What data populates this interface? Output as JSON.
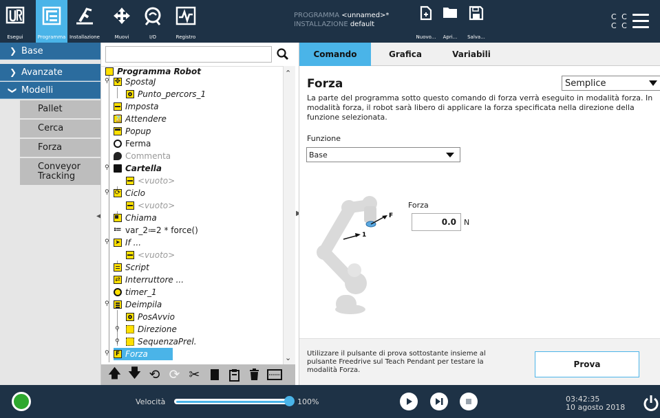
{
  "header": {
    "nav": [
      {
        "label": "Esegui",
        "icon": "ur-logo-icon"
      },
      {
        "label": "Programma",
        "icon": "program-icon",
        "active": true
      },
      {
        "label": "Installazione",
        "icon": "installation-icon"
      },
      {
        "label": "Muovi",
        "icon": "move-icon"
      },
      {
        "label": "I/O",
        "icon": "io-icon"
      },
      {
        "label": "Registro",
        "icon": "log-icon"
      }
    ],
    "program_key": "PROGRAMMA",
    "program_value": "<unnamed>*",
    "installation_key": "INSTALLAZIONE",
    "installation_value": "default",
    "file_buttons": [
      {
        "label": "Nuovo...",
        "icon": "new-file-icon"
      },
      {
        "label": "Apri...",
        "icon": "open-folder-icon"
      },
      {
        "label": "Salva...",
        "icon": "save-icon"
      }
    ],
    "cc_line1": "C C",
    "cc_line2": "C C"
  },
  "leftnav": {
    "sections": [
      {
        "label": "Base",
        "expanded": false
      },
      {
        "label": "Avanzate",
        "expanded": false
      },
      {
        "label": "Modelli",
        "expanded": true
      }
    ],
    "items": [
      "Pallet",
      "Cerca",
      "Forza",
      "Conveyor Tracking"
    ]
  },
  "tree": {
    "search_placeholder": "",
    "rows": [
      {
        "text": "Programma Robot",
        "icon": "program-root-icon"
      },
      {
        "text": "SpostaJ",
        "icon": "move-icon"
      },
      {
        "text": "Punto_percors_1",
        "icon": "waypoint-icon"
      },
      {
        "text": "Imposta",
        "icon": "set-icon"
      },
      {
        "text": "Attendere",
        "icon": "wait-icon"
      },
      {
        "text": "Popup",
        "icon": "popup-icon"
      },
      {
        "text": "Ferma",
        "icon": "halt-icon"
      },
      {
        "text": "Commenta",
        "icon": "comment-icon"
      },
      {
        "text": "Cartella",
        "icon": "folder-icon"
      },
      {
        "text": "<vuoto>",
        "icon": "empty-icon"
      },
      {
        "text": "Ciclo",
        "icon": "loop-icon"
      },
      {
        "text": "<vuoto>",
        "icon": "empty-icon"
      },
      {
        "text": "Chiama",
        "icon": "call-icon"
      },
      {
        "text": "var_2≔2 * force()",
        "icon": "assignment-icon"
      },
      {
        "text": "If ...",
        "icon": "if-icon"
      },
      {
        "text": "<vuoto>",
        "icon": "empty-icon"
      },
      {
        "text": "Script",
        "icon": "script-icon"
      },
      {
        "text": "Interruttore ...",
        "icon": "switch-icon"
      },
      {
        "text": "timer_1",
        "icon": "timer-icon"
      },
      {
        "text": "Deimpila",
        "icon": "destack-icon"
      },
      {
        "text": "PosAvvio",
        "icon": "waypoint-icon"
      },
      {
        "text": "Direzione",
        "icon": "direction-icon"
      },
      {
        "text": "SequenzaPrel.",
        "icon": "sequence-icon"
      },
      {
        "text": "Forza",
        "icon": "force-icon",
        "selected": true
      }
    ],
    "toolbar": [
      "move-up-icon",
      "move-down-icon",
      "undo-icon",
      "redo-icon",
      "cut-icon",
      "copy-icon",
      "paste-icon",
      "delete-icon",
      "suppress-icon"
    ]
  },
  "panel": {
    "tabs": [
      "Comando",
      "Grafica",
      "Variabili"
    ],
    "title": "Forza",
    "mode": "Semplice",
    "description": "La parte del programma sotto questo comando di forza verrà eseguito in modalità forza. In modalità forza, il robot sarà libero di applicare la forza specificata nella direzione della funzione selezionata.",
    "function_label": "Funzione",
    "function_value": "Base",
    "force_label": "Forza",
    "force_value": "0.0",
    "force_unit": "N",
    "arrow_label_f": "F",
    "arrow_label_1": "1",
    "hint": "Utilizzare il pulsante di prova sottostante insieme al pulsante Freedrive sul Teach Pendant per testare la modalità Forza.",
    "test_button": "Prova"
  },
  "footer": {
    "speed_label": "Velocità",
    "speed_value": "100%",
    "speed_fraction": 1.0,
    "time": "03:42:35",
    "date": "10 agosto 2018"
  },
  "colors": {
    "header_bg": "#1e3246",
    "accent": "#4ab4e8",
    "nav_blue": "#2b6c9e",
    "status_green": "#2ea82e",
    "node_yellow": "#ffe000"
  }
}
